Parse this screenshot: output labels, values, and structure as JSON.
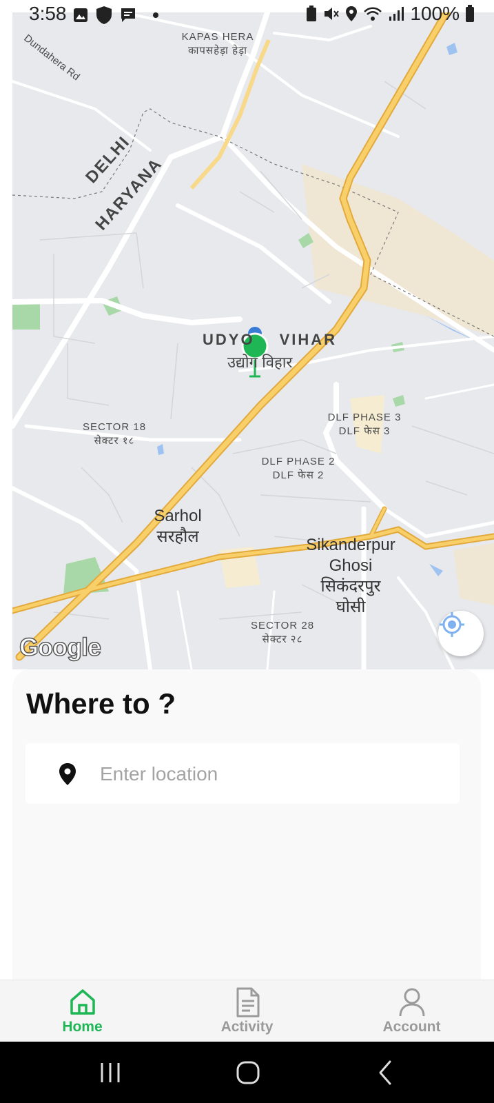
{
  "status_bar": {
    "time": "3:58",
    "battery": "100%"
  },
  "map": {
    "labels": {
      "kapas_hera": "KAPAS HERA",
      "kapas_hera_hi": "कापसहेड़ा हेड़ा",
      "dundahera_rd": "Dundahera Rd",
      "delhi": "DELHI",
      "haryana": "HARYANA",
      "udyog_vihar_prefix": "UDYO",
      "udyog_vihar_suffix": "VIHAR",
      "udyog_vihar_hi": "उद्योग विहार",
      "sector18": "SECTOR 18",
      "sector18_hi": "सेक्टर १८",
      "dlf3": "DLF PHASE 3",
      "dlf3_hi": "DLF फेस 3",
      "dlf2": "DLF PHASE 2",
      "dlf2_hi": "DLF फेस 2",
      "sarhol": "Sarhol",
      "sarhol_hi": "सरहौल",
      "sikanderpur_1": "Sikanderpur",
      "sikanderpur_2": "Ghosi",
      "sikanderpur_hi_1": "सिकंदरपुर",
      "sikanderpur_hi_2": "घोसी",
      "sector28": "SECTOR 28",
      "sector28_hi": "सेक्टर २८"
    },
    "attribution": "Google",
    "my_location_icon": "crosshair-icon",
    "pin_color": "#1fb655"
  },
  "sheet": {
    "title": "Where to ?",
    "search": {
      "placeholder": "Enter location",
      "value": "",
      "icon": "map-pin-icon"
    }
  },
  "tabs": [
    {
      "label": "Home",
      "icon": "home-icon",
      "active": true
    },
    {
      "label": "Activity",
      "icon": "document-icon",
      "active": false
    },
    {
      "label": "Account",
      "icon": "person-icon",
      "active": false
    }
  ],
  "colors": {
    "accent": "#1fb655",
    "inactive": "#9a9a9a",
    "highway": "#f6c54c"
  }
}
